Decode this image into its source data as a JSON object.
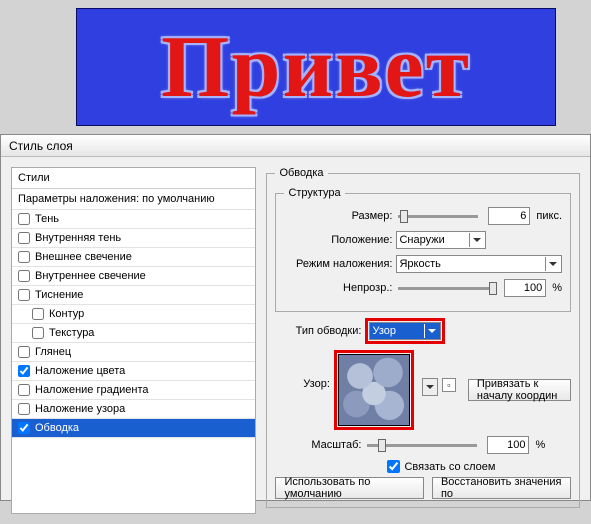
{
  "banner": {
    "text": "Привет"
  },
  "dialog": {
    "title": "Стиль слоя"
  },
  "styles": {
    "header": "Стили",
    "blend_defaults": "Параметры наложения: по умолчанию",
    "items": [
      {
        "label": "Тень",
        "checked": false
      },
      {
        "label": "Внутренняя тень",
        "checked": false
      },
      {
        "label": "Внешнее свечение",
        "checked": false
      },
      {
        "label": "Внутреннее свечение",
        "checked": false
      },
      {
        "label": "Тиснение",
        "checked": false
      },
      {
        "label": "Контур",
        "checked": false,
        "indent": true
      },
      {
        "label": "Текстура",
        "checked": false,
        "indent": true
      },
      {
        "label": "Глянец",
        "checked": false
      },
      {
        "label": "Наложение цвета",
        "checked": true
      },
      {
        "label": "Наложение градиента",
        "checked": false
      },
      {
        "label": "Наложение узора",
        "checked": false
      },
      {
        "label": "Обводка",
        "checked": true,
        "selected": true
      }
    ]
  },
  "stroke": {
    "panel_title": "Обводка",
    "structure_title": "Структура",
    "size_label": "Размер:",
    "size_value": "6",
    "size_unit": "пикс.",
    "position_label": "Положение:",
    "position_value": "Снаружи",
    "blend_label": "Режим наложения:",
    "blend_value": "Яркость",
    "opacity_label": "Непрозр.:",
    "opacity_value": "100",
    "opacity_unit": "%",
    "filltype_label": "Тип обводки:",
    "filltype_value": "Узор",
    "pattern_label": "Узор:",
    "snap_label": "Привязать к началу координ",
    "scale_label": "Масштаб:",
    "scale_value": "100",
    "scale_unit": "%",
    "link_label": "Связать со слоем",
    "defaults_btn": "Использовать по умолчанию",
    "reset_btn": "Восстановить значения по"
  }
}
